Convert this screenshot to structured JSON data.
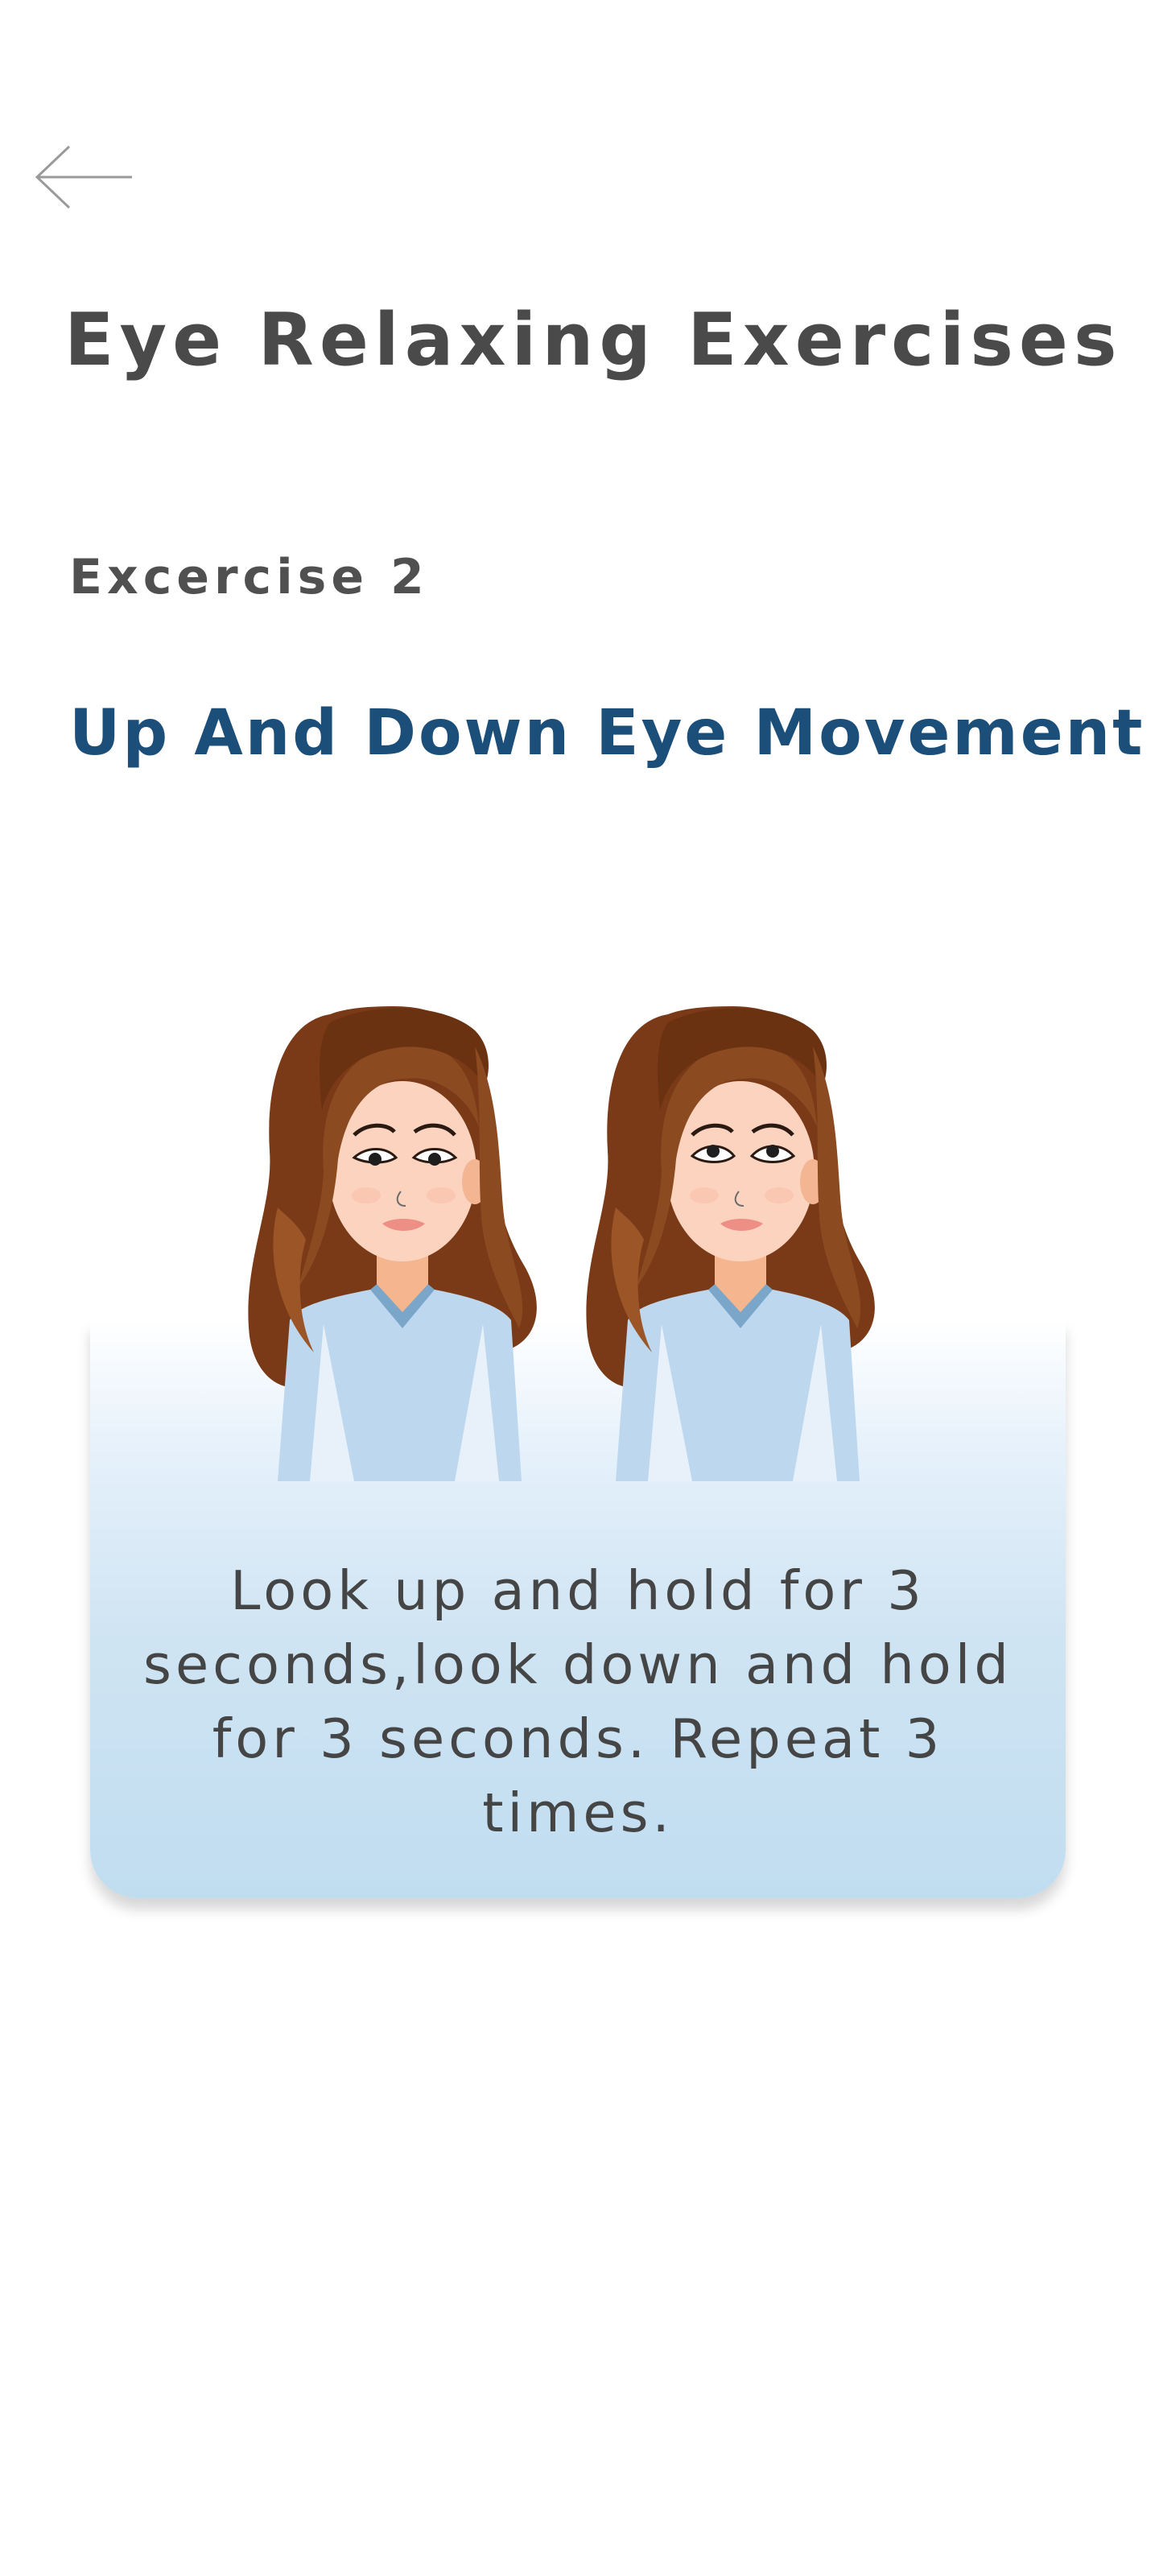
{
  "header": {
    "back_icon": "arrow-left-icon",
    "title": "Eye Relaxing Exercises"
  },
  "exercise": {
    "label": "Excercise 2",
    "name": "Up And Down Eye Movement",
    "illustration": "two-women-looking-up-and-down",
    "instructions": "Look up and hold for 3 seconds,look down and hold for 3 seconds. Repeat 3 times."
  },
  "colors": {
    "title": "#4a4a4a",
    "exercise_name": "#1b4f7a",
    "card_gradient_bottom": "#c0ddf0",
    "hair": "#7a3a17",
    "shirt": "#bcd7ee"
  }
}
